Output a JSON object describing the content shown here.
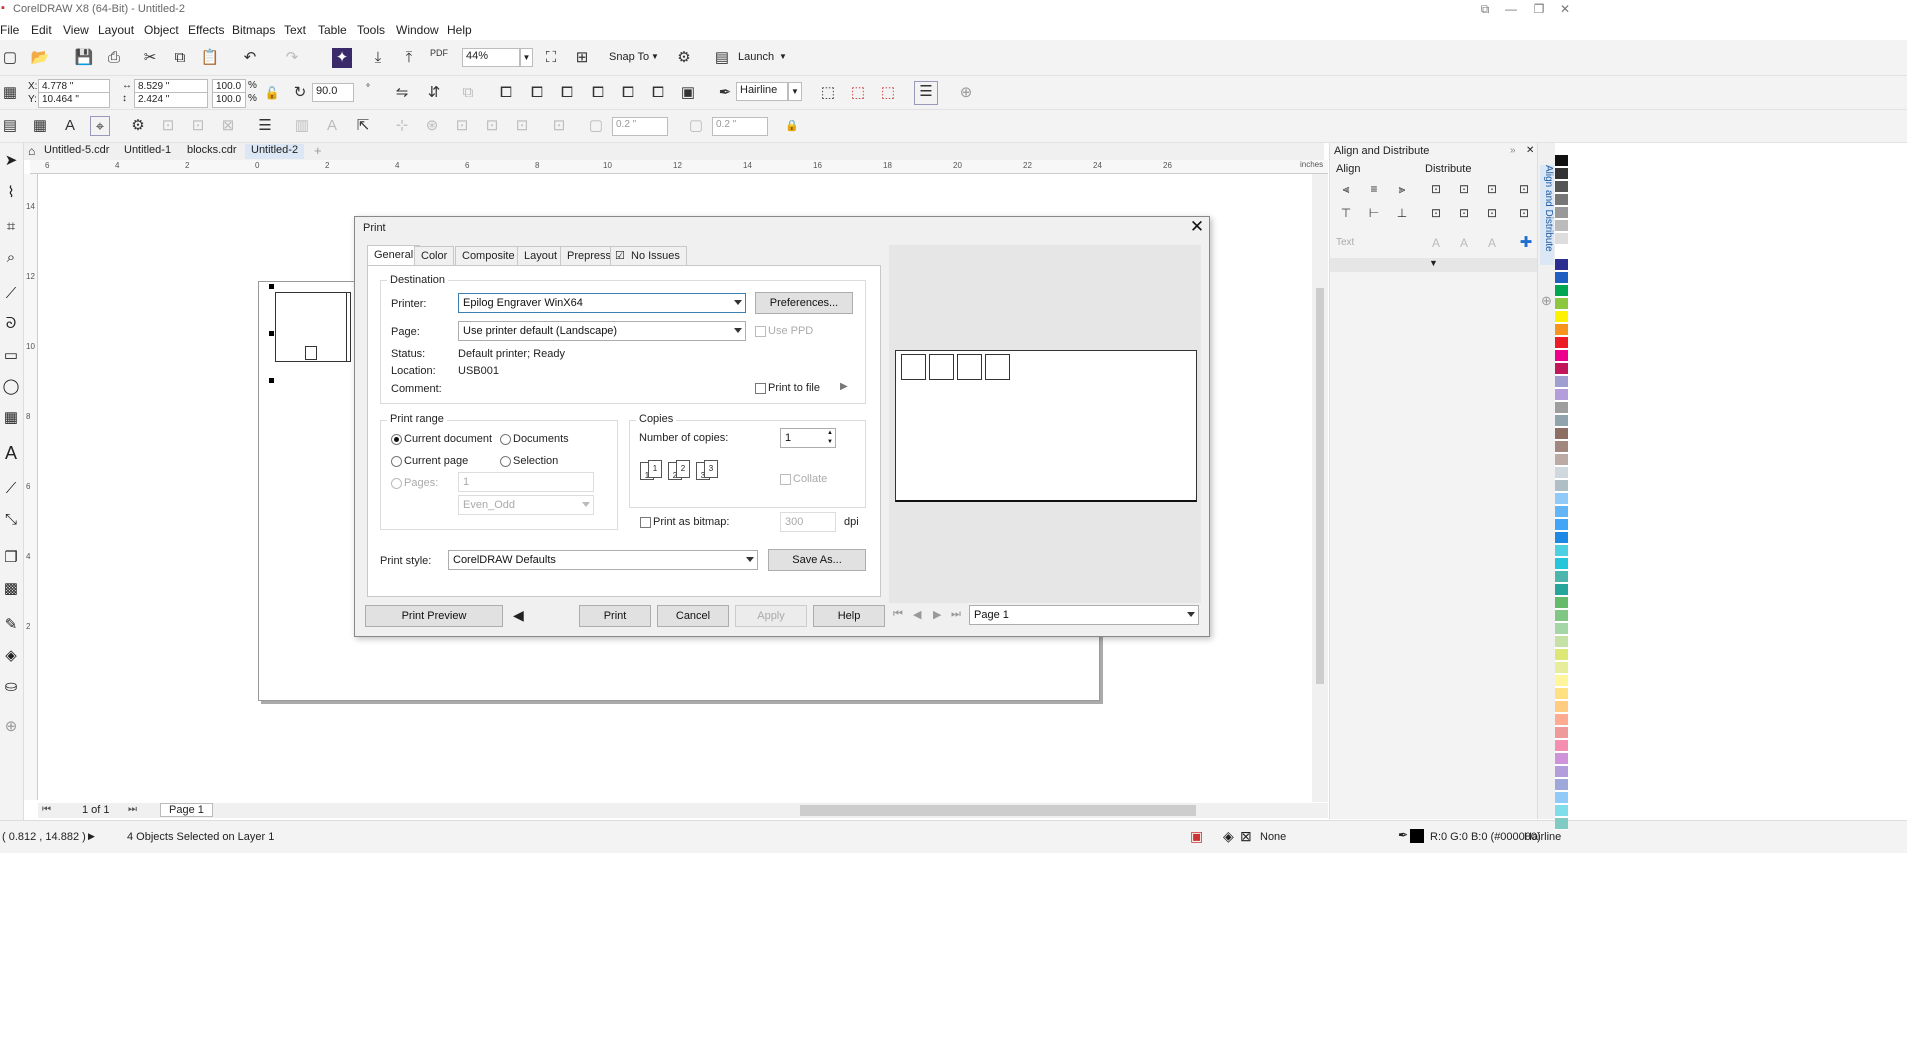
{
  "window": {
    "title": "CorelDRAW X8 (64-Bit) - Untitled-2"
  },
  "menu": [
    "File",
    "Edit",
    "View",
    "Layout",
    "Object",
    "Effects",
    "Bitmaps",
    "Text",
    "Table",
    "Tools",
    "Window",
    "Help"
  ],
  "toolbar": {
    "zoom": "44%",
    "snap_to": "Snap To",
    "launch": "Launch",
    "pdf": "PDF"
  },
  "propbar": {
    "x": "4.778 \"",
    "y": "10.464 \"",
    "w": "8.529 \"",
    "h": "2.424 \"",
    "scale_x": "100.0",
    "scale_y": "100.0",
    "pct": "%",
    "rotation": "90.0",
    "outline": "Hairline"
  },
  "propbar2": {
    "v1": "0.2 \"",
    "v2": "0.2 \""
  },
  "doc_tabs": [
    "Untitled-5.cdr",
    "Untitled-1",
    "blocks.cdr",
    "Untitled-2"
  ],
  "ruler": {
    "unit": "inches",
    "h_ticks": [
      "6",
      "4",
      "2",
      "0",
      "2",
      "4",
      "6",
      "8",
      "10",
      "12",
      "14",
      "16",
      "18",
      "20",
      "22",
      "24",
      "26"
    ],
    "v_ticks": [
      "14",
      "12",
      "10",
      "8",
      "6",
      "4",
      "2"
    ]
  },
  "docker": {
    "title": "Align and Distribute",
    "align": "Align",
    "distribute": "Distribute",
    "text": "Text",
    "vertical_tab": "Align and Distribute"
  },
  "palette": {
    "colors": [
      "#111111",
      "#333333",
      "#555555",
      "#777777",
      "#999999",
      "#bbbbbb",
      "#dddddd",
      "#ffffff",
      "#2b2d8f",
      "#1f5fbf",
      "#00a651",
      "#8dc63f",
      "#fff200",
      "#f7941d",
      "#ed1c24",
      "#ec008c",
      "#c2185b",
      "#a0a0d0",
      "#b39ddb",
      "#9e9e9e",
      "#90a4ae",
      "#8d6e63",
      "#a1887f",
      "#bcaaa4",
      "#cfd8dc",
      "#b0bec5",
      "#90caf9",
      "#64b5f6",
      "#42a5f5",
      "#1e88e5",
      "#4dd0e1",
      "#26c6da",
      "#4db6ac",
      "#26a69a",
      "#66bb6a",
      "#81c784",
      "#a5d6a7",
      "#c5e1a5",
      "#dce775",
      "#e6ee9c",
      "#fff59d",
      "#ffe082",
      "#ffcc80",
      "#ffab91",
      "#ef9a9a",
      "#f48fb1",
      "#ce93d8",
      "#b39ddb",
      "#9fa8da",
      "#90caf9",
      "#80deea",
      "#80cbc4"
    ]
  },
  "status": {
    "coords": "( 0.812 , 14.882 )",
    "selection": "4 Objects Selected on Layer 1",
    "fill": "None",
    "outline_color": "R:0 G:0 B:0 (#000000)",
    "outline_width": "Hairline"
  },
  "pager": {
    "of": "1 of 1",
    "page": "Page 1"
  },
  "dialog": {
    "title": "Print",
    "tabs": [
      "General",
      "Color",
      "Composite",
      "Layout",
      "Prepress",
      "No Issues"
    ],
    "destination": {
      "label": "Destination",
      "printer_label": "Printer:",
      "printer": "Epilog Engraver WinX64",
      "preferences": "Preferences...",
      "page_label": "Page:",
      "page": "Use printer default (Landscape)",
      "use_ppd": "Use PPD",
      "status_label": "Status:",
      "status": "Default printer; Ready",
      "location_label": "Location:",
      "location": "USB001",
      "comment_label": "Comment:",
      "print_to_file": "Print to file"
    },
    "range": {
      "label": "Print range",
      "current_document": "Current document",
      "documents": "Documents",
      "current_page": "Current page",
      "selection": "Selection",
      "pages": "Pages:",
      "pages_value": "1",
      "even_odd": "Even_Odd"
    },
    "copies": {
      "label": "Copies",
      "number_label": "Number of copies:",
      "number": "1",
      "collate": "Collate"
    },
    "bitmap": {
      "label": "Print as bitmap:",
      "dpi_value": "300",
      "dpi": "dpi"
    },
    "style": {
      "label": "Print style:",
      "value": "CorelDRAW Defaults",
      "save_as": "Save As..."
    },
    "buttons": {
      "print_preview": "Print Preview",
      "print": "Print",
      "cancel": "Cancel",
      "apply": "Apply",
      "help": "Help"
    },
    "preview_page": "Page 1"
  }
}
